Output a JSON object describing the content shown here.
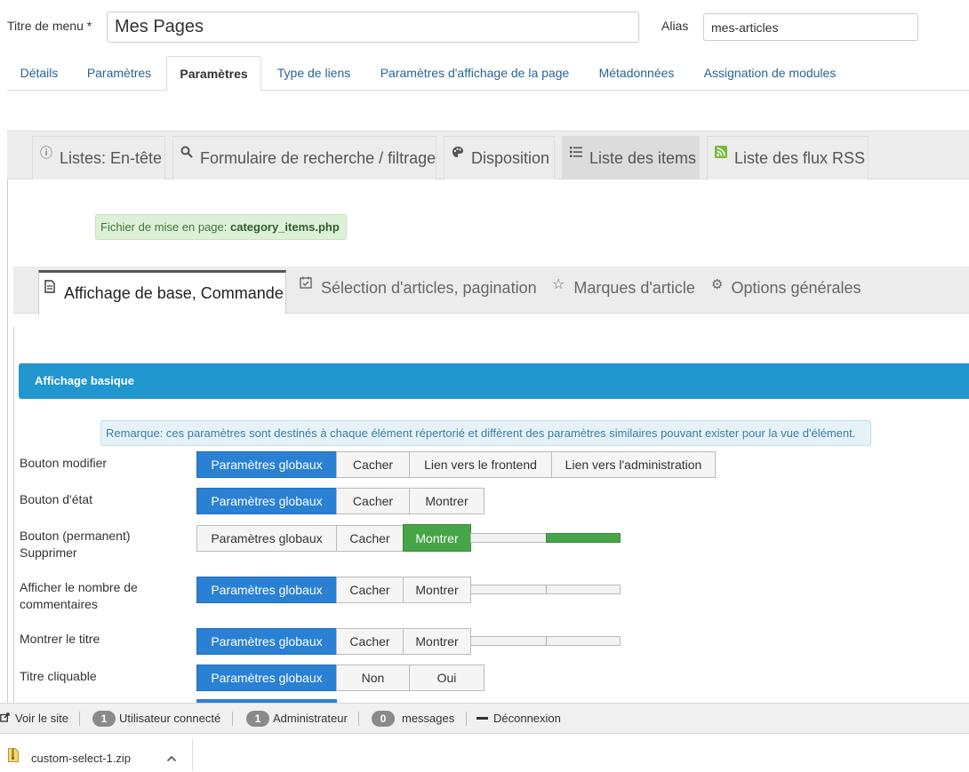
{
  "top": {
    "menu_title_label": "Titre de menu *",
    "menu_title_value": "Mes Pages",
    "alias_label": "Alias",
    "alias_value": "mes-articles"
  },
  "main_tabs": [
    "Détails",
    "Paramètres",
    "Paramètres",
    "Type de liens",
    "Paramètres d'affichage de la page",
    "Métadonnées",
    "Assignation de modules"
  ],
  "sub_tabs": [
    {
      "label": "Listes: En-tête",
      "icon": "info-circle-icon"
    },
    {
      "label": "Formulaire de recherche / filtrage",
      "icon": "search-icon"
    },
    {
      "label": "Disposition",
      "icon": "palette-icon"
    },
    {
      "label": "Liste des items",
      "icon": "list-icon"
    },
    {
      "label": "Liste des flux RSS",
      "icon": "rss-icon"
    }
  ],
  "layout_file": {
    "label": "Fichier de mise en page:",
    "value": "category_items.php"
  },
  "inner_tabs": [
    {
      "label": "Affichage de base, Commande",
      "icon": "document-icon"
    },
    {
      "label": "Sélection d'articles, pagination",
      "icon": "checklist-icon"
    },
    {
      "label": "Marques d'article",
      "icon": "star-icon"
    },
    {
      "label": "Options générales",
      "icon": "gear-icon"
    }
  ],
  "section_title": "Affichage basique",
  "remark": "Remarque: ces paramètres sont destinés à chaque élément répertorié et diffèrent des paramètres similaires pouvant exister pour la vue d'élément.",
  "rows": [
    {
      "label": "Bouton modifier",
      "options": [
        "Paramètres globaux",
        "Cacher",
        "Lien vers le frontend",
        "Lien vers l'administration"
      ],
      "selected": 0
    },
    {
      "label": "Bouton d'état",
      "options": [
        "Paramètres globaux",
        "Cacher",
        "Montrer"
      ],
      "selected": 0
    },
    {
      "label": "Bouton (permanent) Supprimer",
      "options": [
        "Paramètres globaux",
        "Cacher",
        "Montrer"
      ],
      "selected": 2
    },
    {
      "label": "Afficher le nombre de commentaires",
      "options": [
        "Paramètres globaux",
        "Cacher",
        "Montrer"
      ],
      "selected": 0
    },
    {
      "label": "Montrer le titre",
      "options": [
        "Paramètres globaux",
        "Cacher",
        "Montrer"
      ],
      "selected": 0
    },
    {
      "label": "Titre cliquable",
      "options": [
        "Paramètres globaux",
        "Non",
        "Oui"
      ],
      "selected": 0
    }
  ],
  "statusbar": {
    "view_site": "Voir le site",
    "users_count": "1",
    "users_label": "Utilisateur connecté",
    "admins_count": "1",
    "admins_label": "Administrateur",
    "messages_count": "0",
    "messages_label": "messages",
    "logout": "Déconnexion"
  },
  "download": {
    "filename": "custom-select-1.zip"
  },
  "colors": {
    "primary": "#2a81d4",
    "success": "#46a546",
    "section": "#2196cf"
  }
}
